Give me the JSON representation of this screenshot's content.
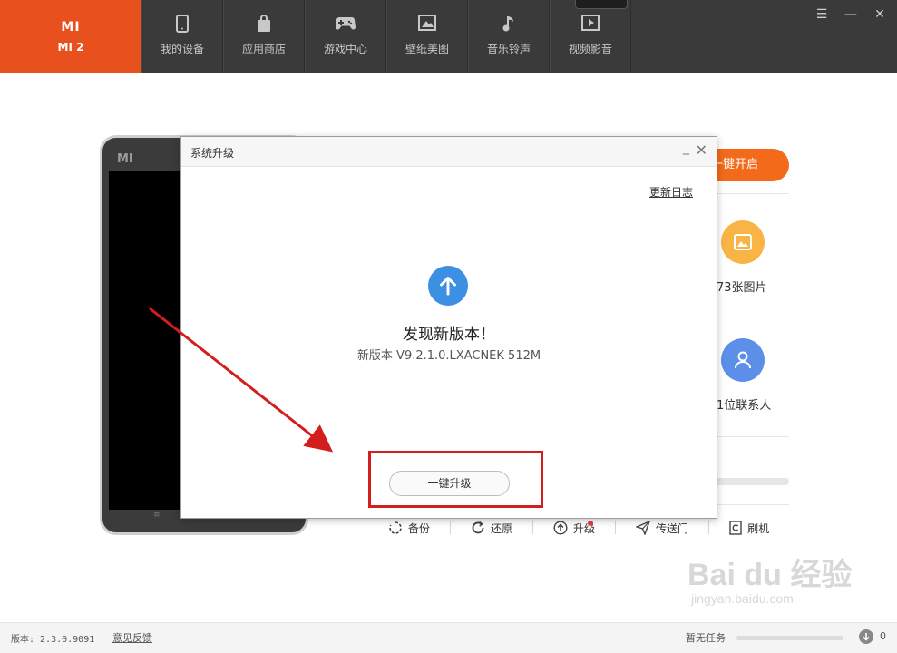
{
  "header": {
    "brand_logo": "MI",
    "brand_model": "MI 2",
    "nav": [
      {
        "label": "我的设备",
        "icon": "phone-icon"
      },
      {
        "label": "应用商店",
        "icon": "shopping-bag-icon"
      },
      {
        "label": "游戏中心",
        "icon": "gamepad-icon"
      },
      {
        "label": "壁纸美图",
        "icon": "picture-icon"
      },
      {
        "label": "音乐铃声",
        "icon": "music-note-icon"
      },
      {
        "label": "视频影音",
        "icon": "play-video-icon"
      }
    ],
    "window_controls": [
      "menu-icon",
      "minimize-icon",
      "close-icon"
    ]
  },
  "phone": {
    "logo": "MI"
  },
  "main": {
    "open_button": "一键开启",
    "photos_stat": "73张图片",
    "contacts_stat": "1位联系人",
    "actions": [
      {
        "label": "备份",
        "icon": "backup-icon"
      },
      {
        "label": "还原",
        "icon": "restore-icon"
      },
      {
        "label": "升级",
        "icon": "upgrade-icon"
      },
      {
        "label": "传送门",
        "icon": "send-icon"
      },
      {
        "label": "刷机",
        "icon": "flash-icon"
      }
    ]
  },
  "dialog": {
    "title": "系统升级",
    "changelog_link": "更新日志",
    "heading": "发现新版本！",
    "version_line": "新版本  V9.2.1.0.LXACNEK  512M",
    "upgrade_button": "一键升级"
  },
  "status_bar": {
    "version": "版本: 2.3.0.9091",
    "feedback": "意见反馈",
    "task": "暂无任务",
    "download_count": "0"
  },
  "watermark": {
    "text": "Bai du 经验",
    "url": "jingyan.baidu.com"
  },
  "colors": {
    "brand": "#e8501e",
    "topbar": "#3a3a3a",
    "accent_orange": "#f36a1a",
    "photo_circle": "#f8b546",
    "contact_circle": "#5b8fe8",
    "upgrade_icon": "#3c8fe3",
    "annotation_red": "#d41e1e"
  }
}
